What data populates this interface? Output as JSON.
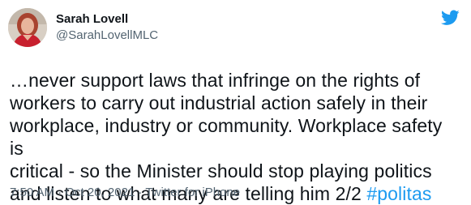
{
  "tweet": {
    "author": {
      "display_name": "Sarah Lovell",
      "handle": "@SarahLovellMLC",
      "avatar": "avatar-photo"
    },
    "text": "…never support laws that infringe on the rights of\nworkers to carry out industrial action safely in their\nworkplace, industry or community. Workplace safety is\ncritical - so the Minister should stop playing politics\nand listen to what many are telling him 2/2 ",
    "hashtag": "#politas",
    "time": "7:50 AM",
    "separator": " · ",
    "date": "Oct 20, 2021",
    "source": "Twitter for iPhone",
    "logo": "twitter-bird-icon"
  },
  "colors": {
    "text": "#0f1419",
    "secondary": "#536471",
    "link": "#1d9bf0",
    "logo": "#1d9bf0"
  }
}
